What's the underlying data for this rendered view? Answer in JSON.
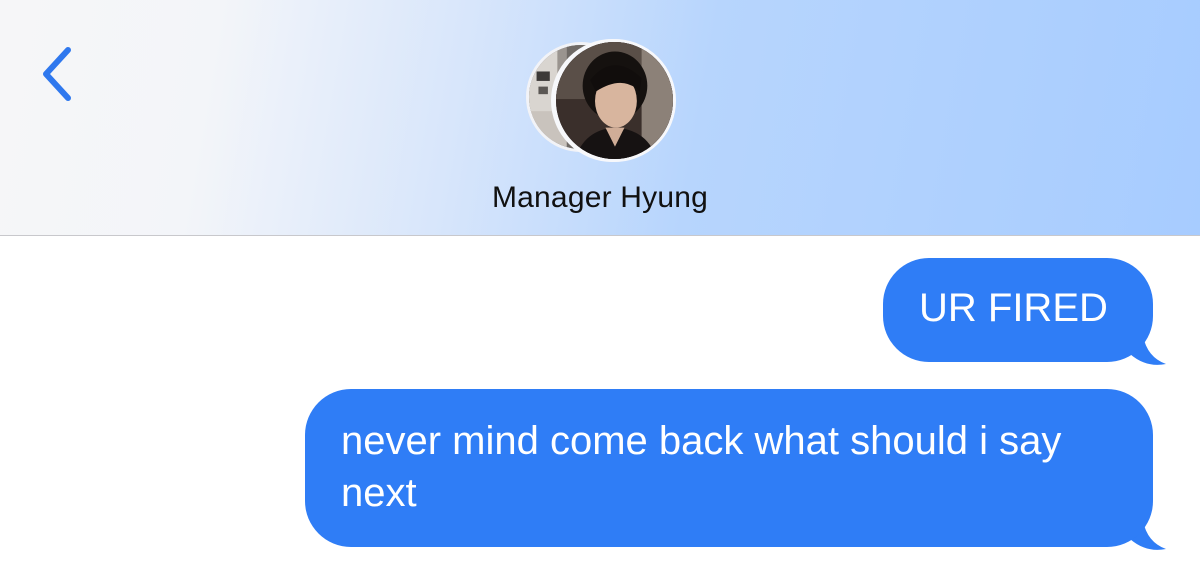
{
  "header": {
    "back_icon": "chevron-left-icon",
    "contact_name": "Manager Hyung",
    "avatars": [
      "avatar-photo",
      "avatar-photo"
    ]
  },
  "messages": [
    {
      "text": "UR FIRED",
      "direction": "outgoing",
      "color": "#2f7df6"
    },
    {
      "text": "never mind come back what should i say next",
      "direction": "outgoing",
      "color": "#2f7df6"
    }
  ],
  "colors": {
    "accent": "#1a73e8",
    "bubble": "#2f7df6",
    "header_gradient_end": "#a7ccff"
  }
}
